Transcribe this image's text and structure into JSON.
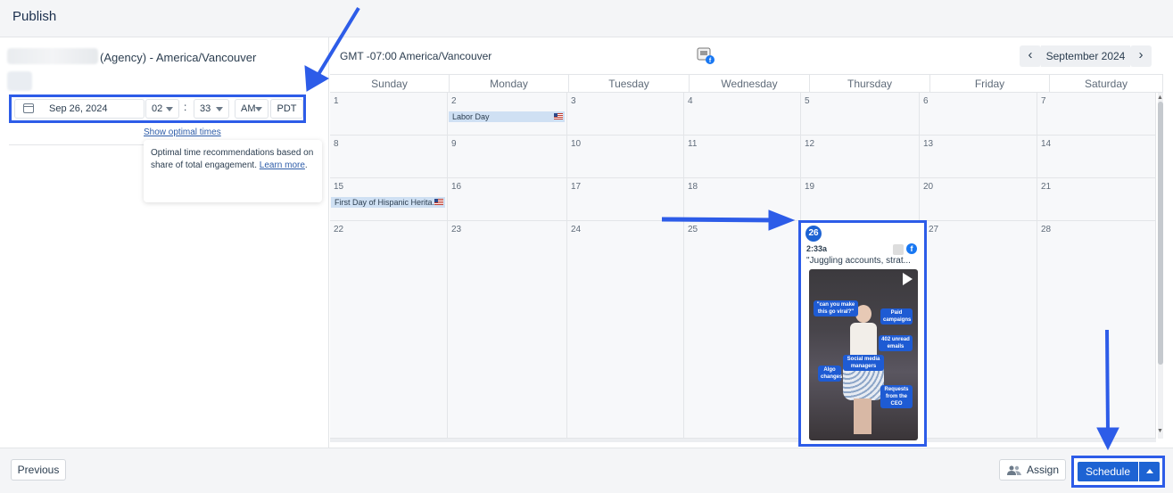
{
  "header": {
    "title": "Publish"
  },
  "account": {
    "label": "(Agency) - America/Vancouver"
  },
  "datetime": {
    "date": "Sep 26, 2024",
    "hour": "02",
    "minute": "33",
    "ampm": "AM",
    "tz": "PDT"
  },
  "optimal": {
    "link": "Show optimal times",
    "tip": "Optimal time recommendations based on share of total engagement.",
    "learn_more": "Learn more"
  },
  "calendar": {
    "timezone": "GMT -07:00 America/Vancouver",
    "month": "September 2024",
    "weekdays": [
      "Sunday",
      "Monday",
      "Tuesday",
      "Wednesday",
      "Thursday",
      "Friday",
      "Saturday"
    ],
    "weeks": [
      [
        "1",
        "2",
        "3",
        "4",
        "5",
        "6",
        "7"
      ],
      [
        "8",
        "9",
        "10",
        "11",
        "12",
        "13",
        "14"
      ],
      [
        "15",
        "16",
        "17",
        "18",
        "19",
        "20",
        "21"
      ],
      [
        "22",
        "23",
        "24",
        "25",
        "26",
        "27",
        "28"
      ]
    ],
    "holidays": {
      "labor_day": "Labor Day",
      "hispanic": "First Day of Hispanic Herita..."
    },
    "event": {
      "day": "26",
      "time": "2:33a",
      "caption": "\"Juggling accounts, strat...",
      "chips": {
        "c1": "\"can you make this go viral?\"",
        "c2": "Paid campaigns",
        "c3": "402 unread emails",
        "c4": "Social media managers",
        "c5": "Algo changes",
        "c6": "Requests from the CEO"
      }
    }
  },
  "footer": {
    "previous": "Previous",
    "assign": "Assign",
    "schedule": "Schedule"
  },
  "colors": {
    "accent": "#1d63d3",
    "annotation": "#2d5ce8",
    "facebook": "#1877f2"
  }
}
